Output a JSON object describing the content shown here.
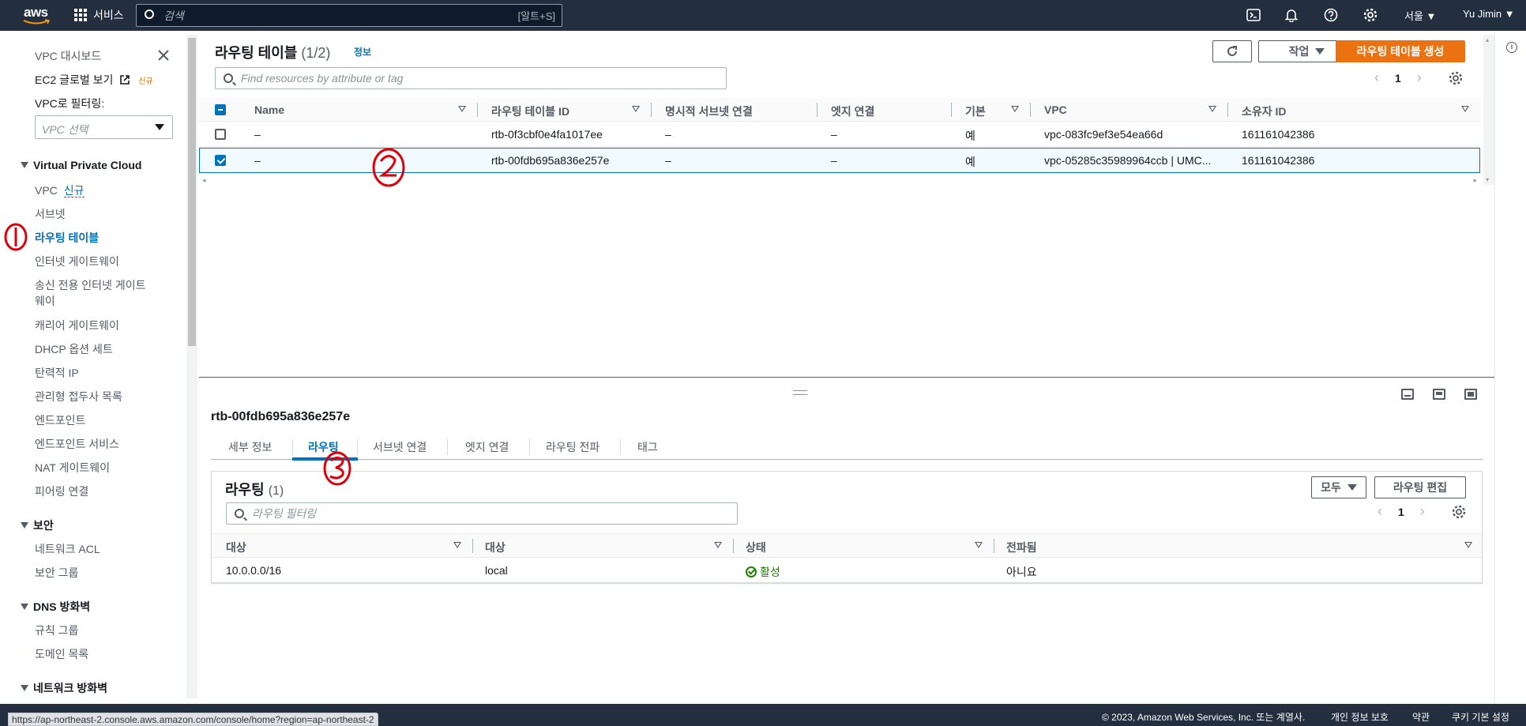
{
  "topnav": {
    "logo": "aws",
    "services_label": "서비스",
    "search_placeholder": "검색",
    "search_shortcut": "[알트+S]",
    "region": "서울 ▼",
    "user": "Yu Jimin ▼",
    "icons": [
      "cloudshell-icon",
      "bell-icon",
      "help-icon",
      "settings-icon"
    ]
  },
  "sidebar": {
    "dashboard": "VPC 대시보드",
    "ec2_global": "EC2 글로벌 보기",
    "ec2_global_badge": "신규",
    "filter_label": "VPC로 필터링:",
    "filter_placeholder": "VPC 선택",
    "section_vpc": "Virtual Private Cloud",
    "vpc_items": [
      {
        "label": "VPC",
        "badge": "신규"
      },
      {
        "label": "서브넷"
      },
      {
        "label": "라우팅 테이블"
      },
      {
        "label": "인터넷 게이트웨이"
      },
      {
        "label": "송신 전용 인터넷 게이트"
      },
      {
        "label": "웨이"
      },
      {
        "label": "캐리어 게이트웨이"
      },
      {
        "label": "DHCP 옵션 세트"
      },
      {
        "label": "탄력적 IP"
      },
      {
        "label": "관리형 접두사 목록"
      },
      {
        "label": "엔드포인트"
      },
      {
        "label": "엔드포인트 서비스"
      },
      {
        "label": "NAT 게이트웨이"
      },
      {
        "label": "피어링 연결"
      }
    ],
    "section_security": "보안",
    "security_items": [
      "네트워크 ACL",
      "보안 그룹"
    ],
    "section_dns": "DNS 방화벽",
    "dns_items": [
      "규칙 그룹",
      "도메인 목록"
    ],
    "section_nfw": "네트워크 방화벽"
  },
  "main": {
    "title": "라우팅 테이블",
    "count": "(1/2)",
    "info": "정보",
    "refresh_icon": "refresh-icon",
    "actions_label": "작업",
    "create_label": "라우팅 테이블 생성",
    "filter_placeholder": "Find resources by attribute or tag",
    "page": "1",
    "columns": [
      "Name",
      "라우팅 테이블 ID",
      "명시적 서브넷 연결",
      "엣지 연결",
      "기본",
      "VPC",
      "소유자 ID"
    ],
    "rows": [
      {
        "name": "–",
        "id": "rtb-0f3cbf0e4fa1017ee",
        "subnet": "–",
        "edge": "–",
        "main": "예",
        "vpc": "vpc-083fc9ef3e54ea66d",
        "owner": "161161042386",
        "selected": false
      },
      {
        "name": "–",
        "id": "rtb-00fdb695a836e257e",
        "subnet": "–",
        "edge": "–",
        "main": "예",
        "vpc": "vpc-05285c35989964ccb | UMC...",
        "owner": "161161042386",
        "selected": true
      }
    ]
  },
  "detail": {
    "title": "rtb-00fdb695a836e257e",
    "tabs": [
      "세부 정보",
      "라우팅",
      "서브넷 연결",
      "엣지 연결",
      "라우팅 전파",
      "태그"
    ],
    "active_tab": "라우팅",
    "routes_title": "라우팅",
    "routes_count": "(1)",
    "all_label": "모두",
    "edit_label": "라우팅 편집",
    "routes_filter_placeholder": "라우팅 필터링",
    "page": "1",
    "route_columns": [
      "대상",
      "대상",
      "상태",
      "전파됨"
    ],
    "routes": [
      {
        "destination": "10.0.0.0/16",
        "target": "local",
        "status": "활성",
        "propagated": "아니요"
      }
    ]
  },
  "footer": {
    "copyright": "© 2023, Amazon Web Services, Inc. 또는 계열사.",
    "privacy": "개인 정보 보호",
    "terms": "약관",
    "cookies": "쿠키 기본 설정",
    "status_url": "https://ap-northeast-2.console.aws.amazon.com/console/home?region=ap-northeast-2"
  },
  "colors": {
    "nav_bg": "#232f3e",
    "primary": "#ec7211",
    "link": "#0073bb",
    "success": "#1d8102",
    "annotation": "#e0000b"
  }
}
